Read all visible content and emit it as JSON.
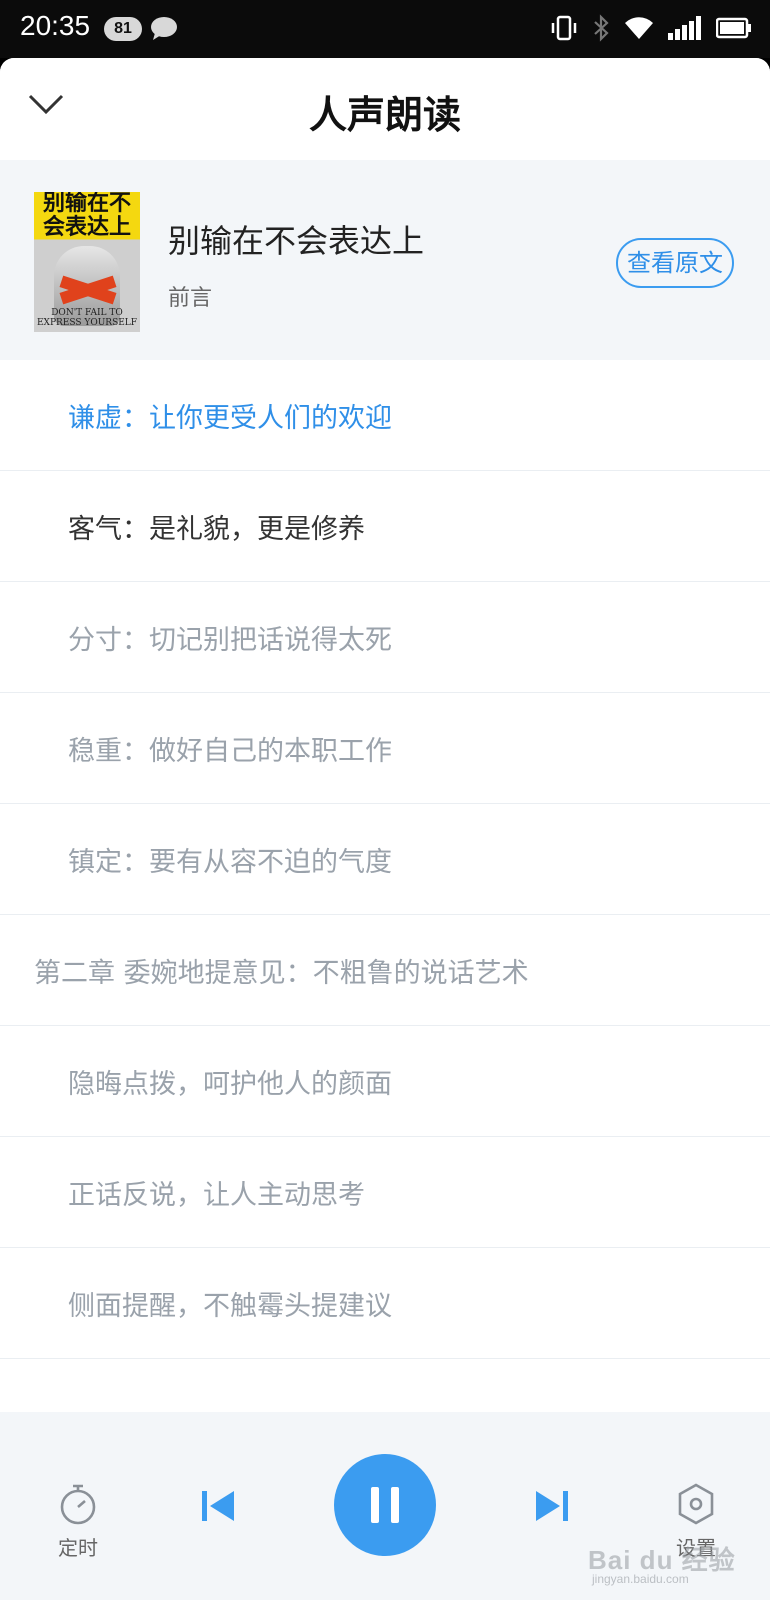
{
  "status_bar": {
    "time": "20:35",
    "badge": "81",
    "icons": [
      "vibrate-icon",
      "bluetooth-icon",
      "wifi-icon",
      "signal-icon",
      "battery-icon"
    ]
  },
  "header": {
    "title": "人声朗读",
    "back_icon": "chevron-down-icon"
  },
  "book": {
    "title": "别输在不会表达上",
    "chapter": "前言",
    "view_original": "查看原文",
    "cover": {
      "title": "别输在不会表达上",
      "subtitle": "DON'T FAIL TO EXPRESS YOURSELF"
    }
  },
  "toc": [
    {
      "label": "谦虚：让你更受人们的欢迎",
      "level": "sub",
      "state": "active"
    },
    {
      "label": "客气：是礼貌，更是修养",
      "level": "sub",
      "state": "played"
    },
    {
      "label": "分寸：切记别把话说得太死",
      "level": "sub",
      "state": "normal"
    },
    {
      "label": "稳重：做好自己的本职工作",
      "level": "sub",
      "state": "normal"
    },
    {
      "label": "镇定：要有从容不迫的气度",
      "level": "sub",
      "state": "normal"
    },
    {
      "label": "第二章 委婉地提意见：不粗鲁的说话艺术",
      "level": "chap",
      "state": "normal"
    },
    {
      "label": "隐晦点拨，呵护他人的颜面",
      "level": "sub",
      "state": "normal"
    },
    {
      "label": "正话反说，让人主动思考",
      "level": "sub",
      "state": "normal"
    },
    {
      "label": "侧面提醒，不触霉头提建议",
      "level": "sub",
      "state": "normal"
    }
  ],
  "player": {
    "timer_label": "定时",
    "settings_label": "设置",
    "watermark": "Bai du 经验",
    "watermark_url": "jingyan.baidu.com",
    "accent": "#3b9cf0"
  }
}
